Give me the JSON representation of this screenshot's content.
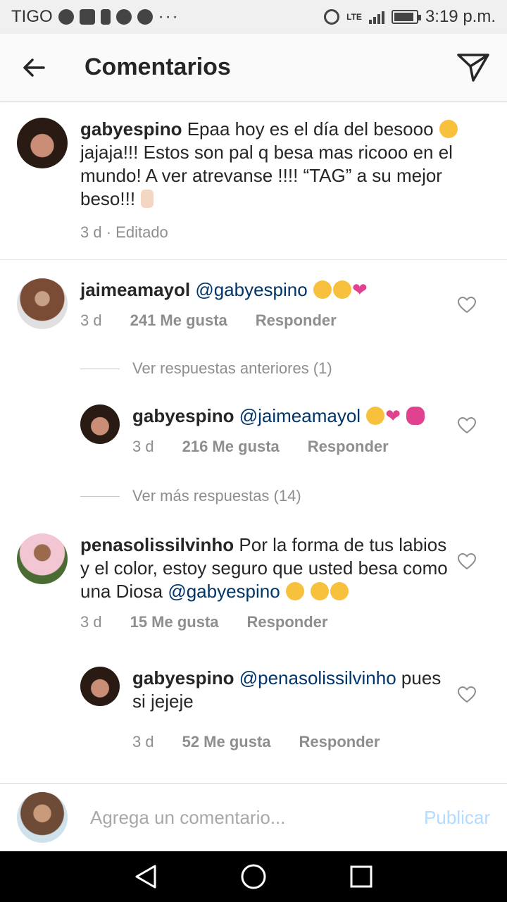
{
  "statusbar": {
    "carrier": "TIGO",
    "network": "LTE",
    "time": "3:19 p.m.",
    "battery_level": 0.9,
    "more": "···"
  },
  "header": {
    "title": "Comentarios"
  },
  "caption": {
    "user": "gabyespino",
    "text_1": "Epaa hoy es el día del besooo",
    "text_2": "jajaja!!! Estos son pal q besa mas ricooo en el mundo!",
    "text_3": "A ver atrevanse !!!! “TAG” a su mejor beso!!!",
    "time": "3 d",
    "sep": "·",
    "edited": "Editado"
  },
  "comments": [
    {
      "user": "jaimeamayol",
      "mention": "@gabyespino",
      "time": "3 d",
      "likes": "241 Me gusta",
      "reply": "Responder"
    },
    {
      "user": "gabyespino",
      "mention": "@jaimeamayol",
      "time": "3 d",
      "likes": "216 Me gusta",
      "reply": "Responder"
    },
    {
      "user": "penasolissilvinho",
      "text": "Por la forma de tus labios y el color, estoy seguro que usted besa como una Diosa",
      "mention": "@gabyespino",
      "time": "3 d",
      "likes": "15 Me gusta",
      "reply": "Responder"
    },
    {
      "user": "gabyespino",
      "mention": "@penasolissilvinho",
      "text": "pues si",
      "text_2": "jejeje",
      "time": "3 d",
      "likes": "52 Me gusta",
      "reply": "Responder"
    }
  ],
  "view_previous": "Ver respuestas anteriores (1)",
  "view_more": "Ver más respuestas (14)",
  "composer": {
    "placeholder": "Agrega un comentario...",
    "publish": "Publicar"
  },
  "colors": {
    "mention": "#003569",
    "meta": "#8e8e8e",
    "publish_disabled": "#b3dbff"
  }
}
